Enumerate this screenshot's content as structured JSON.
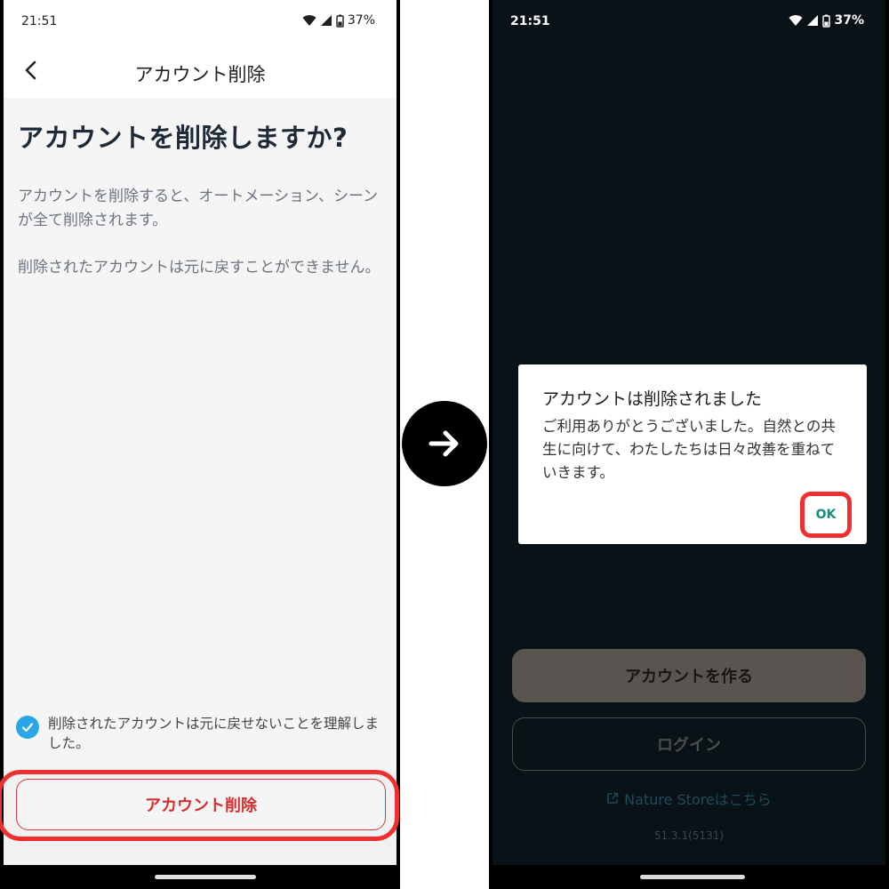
{
  "before": {
    "status": {
      "time": "21:51",
      "battery": "37%"
    },
    "appbar": {
      "title": "アカウント削除"
    },
    "heading": "アカウントを削除しますか?",
    "paragraphs": [
      "アカウントを削除すると、オートメーション、シーンが全て削除されます。",
      "削除されたアカウントは元に戻すことができません。"
    ],
    "confirm_checkbox": {
      "label": "削除されたアカウントは元に戻せないことを理解しました。",
      "checked": true
    },
    "delete_button": "アカウント削除"
  },
  "after": {
    "status": {
      "time": "21:51",
      "battery": "37%"
    },
    "dialog": {
      "title": "アカウントは削除されました",
      "body": "ご利用ありがとうございました。自然との共生に向けて、わたしたちは日々改善を重ねていきます。",
      "ok_label": "OK"
    },
    "create_account_button": "アカウントを作る",
    "login_button": "ログイン",
    "store_link": "Nature Storeはこちら",
    "version": "51.3.1(5131)"
  },
  "colors": {
    "highlight": "#f03030",
    "checkbox": "#2aa6e6",
    "ok_text": "#1a8c7c",
    "dark_bg": "#091217"
  }
}
